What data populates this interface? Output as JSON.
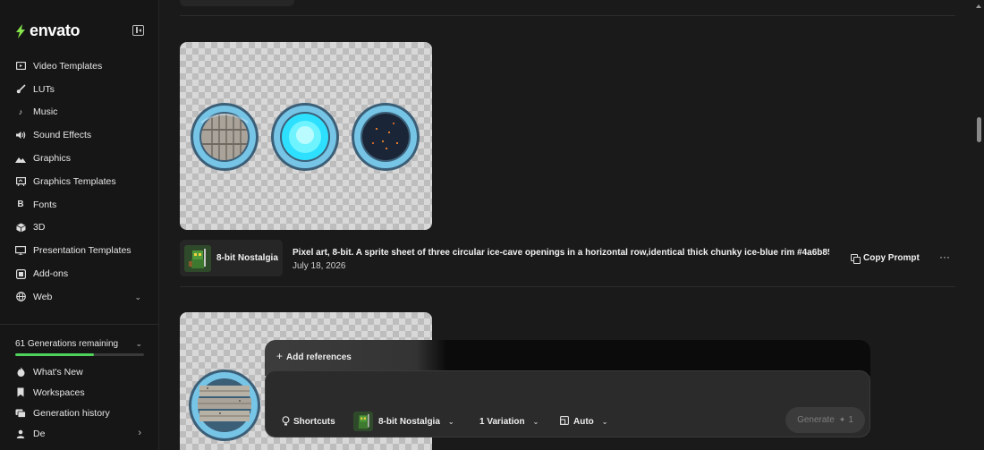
{
  "brand": {
    "name": "envato",
    "accent": "#87e64b"
  },
  "sidebar": {
    "items": [
      {
        "label": "Video Templates",
        "icon": "video-icon"
      },
      {
        "label": "LUTs",
        "icon": "brush-icon"
      },
      {
        "label": "Music",
        "icon": "music-note-icon"
      },
      {
        "label": "Sound Effects",
        "icon": "speaker-icon"
      },
      {
        "label": "Graphics",
        "icon": "mountain-icon"
      },
      {
        "label": "Graphics Templates",
        "icon": "template-icon"
      },
      {
        "label": "Fonts",
        "icon": "font-icon"
      },
      {
        "label": "3D",
        "icon": "cube-icon"
      },
      {
        "label": "Presentation Templates",
        "icon": "presentation-icon"
      },
      {
        "label": "Add-ons",
        "icon": "addon-icon"
      },
      {
        "label": "Web",
        "icon": "globe-icon"
      }
    ],
    "generations": {
      "label": "61 Generations remaining",
      "fraction": 0.61,
      "bar_color": "#4ed45a"
    },
    "bottom_items": [
      {
        "label": "What's New",
        "icon": "flame-icon"
      },
      {
        "label": "Workspaces",
        "icon": "bookmark-icon"
      },
      {
        "label": "Generation history",
        "icon": "history-icon"
      },
      {
        "label": "De",
        "icon": "user-icon"
      }
    ]
  },
  "feed": {
    "item": {
      "style_name": "8-bit Nostalgia",
      "prompt": "Pixel art, 8-bit. A sprite sheet of three circular ice-cave openings in a horizontal row,identical thick chunky ice-blue rim #4a6b85...",
      "date": "July 18, 2026",
      "copy_label": "Copy Prompt",
      "more_label": "···"
    }
  },
  "composer": {
    "add_references": "Add references",
    "prompt_placeholder": "",
    "shortcuts": "Shortcuts",
    "style": "8-bit Nostalgia",
    "variations": "1 Variation",
    "ratio": "Auto",
    "generate": "Generate",
    "generate_cost": "1"
  }
}
